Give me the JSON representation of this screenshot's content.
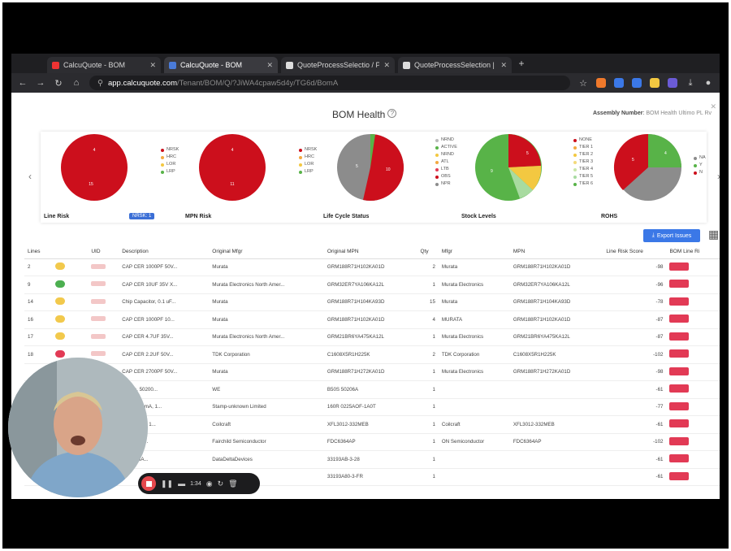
{
  "browser": {
    "tabs": [
      {
        "label": "CalcuQuote - BOM",
        "active": false,
        "icon": "calcuquote-icon"
      },
      {
        "label": "CalcuQuote - BOM",
        "active": true,
        "icon": "calcuquote-icon"
      },
      {
        "label": "QuoteProcessSelectio / Pro",
        "active": false,
        "icon": "doc-icon"
      },
      {
        "label": "QuoteProcessSelection | Do",
        "active": false,
        "icon": "doc-icon"
      }
    ],
    "url_host": "app.calcuquote.com",
    "url_path": "/Tenant/BOM/Q/?JiWA4cpaw5d4y/TG6d/BomA"
  },
  "app": {
    "title": "BOM Health",
    "assembly_label": "Assembly Number",
    "assembly_value": "BOM Health Ultimo PL Rv",
    "charts": [
      {
        "title": "Line Risk",
        "legend": [
          "NRSK",
          "HRC",
          "LOR",
          "LRP"
        ]
      },
      {
        "title": "MPN Risk",
        "legend": [
          "NRSK",
          "HRC",
          "LOR",
          "LRP"
        ]
      },
      {
        "title": "Life Cycle Status",
        "legend": [
          "NRND",
          "ACTIVE",
          "NRND",
          "ATL",
          "LTB",
          "OBS",
          "NPR"
        ]
      },
      {
        "title": "Stock Levels",
        "legend": [
          "NONE",
          "TIER 1",
          "TIER 2",
          "TIER 3",
          "TIER 4",
          "TIER 5",
          "TIER 6"
        ]
      },
      {
        "title": "ROHS",
        "legend": [
          "NA",
          "Y",
          "N"
        ]
      }
    ],
    "hover_chip": "NRSK: 1",
    "export_label": "Export Issues",
    "columns": [
      "Lines",
      "",
      "UID",
      "Description",
      "Original Mfgr",
      "Original MPN",
      "Qty",
      "Mfgr",
      "MPN",
      "Line Risk Score",
      "BOM Line Ri"
    ],
    "rows": [
      {
        "line": "2",
        "color": "#f2c94c",
        "desc": "CAP CER 1000PF 50V...",
        "omfg": "Murata",
        "ompn": "GRM188R71H102KA01D",
        "qty": "2",
        "mfgr": "Murata",
        "mpn": "GRM188R71H102KA01D",
        "score": "-98"
      },
      {
        "line": "9",
        "color": "#4caf50",
        "desc": "CAP CER 10UF 35V X...",
        "omfg": "Murata Electronics North Amer...",
        "ompn": "GRM32ER7YA106KA12L",
        "qty": "1",
        "mfgr": "Murata Electronics",
        "mpn": "GRM32ER7YA106KA12L",
        "score": "-96"
      },
      {
        "line": "14",
        "color": "#f2c94c",
        "desc": "Chip Capacitor, 0.1 uF...",
        "omfg": "Murata",
        "ompn": "GRM188R71H104KA93D",
        "qty": "15",
        "mfgr": "Murata",
        "mpn": "GRM188R71H104KA93D",
        "score": "-78"
      },
      {
        "line": "16",
        "color": "#f2c94c",
        "desc": "CAP CER 1000PF 10...",
        "omfg": "Murata",
        "ompn": "GRM188R71H102KA01D",
        "qty": "4",
        "mfgr": "MURATA",
        "mpn": "GRM188R71H102KA01D",
        "score": "-87"
      },
      {
        "line": "17",
        "color": "#f2c94c",
        "desc": "CAP CER 4.7UF 35V...",
        "omfg": "Murata Electronics North Amer...",
        "ompn": "GRM21BR6YA475KA12L",
        "qty": "1",
        "mfgr": "Murata Electronics",
        "mpn": "GRM21BR6YA475KA12L",
        "score": "-87"
      },
      {
        "line": "18",
        "color": "#e23a55",
        "desc": "CAP CER 2.2UF 50V...",
        "omfg": "TDK Corporation",
        "ompn": "C1608X5R1H225K",
        "qty": "2",
        "mfgr": "TDK Corporation",
        "mpn": "C1608X5R1H225K",
        "score": "-102"
      },
      {
        "line": "",
        "color": "#f2c94c",
        "desc": "CAP CER 2700PF 50V...",
        "omfg": "Murata",
        "ompn": "GRM188R71H272KA01D",
        "qty": "1",
        "mfgr": "Murata Electronics",
        "mpn": "GRM188R71H272KA01D",
        "score": "-98"
      },
      {
        "line": "",
        "color": "#f2c94c",
        "desc": "Bridge, 50200...",
        "omfg": "WE",
        "ompn": "B50S 50206A",
        "qty": "1",
        "mfgr": "",
        "mpn": "",
        "score": "-61"
      },
      {
        "line": "",
        "color": "#f2c94c",
        "desc": "Fuse, 400mA, 1...",
        "omfg": "Stamp-unknown Limited",
        "ompn": "160R 0225AOF-1A0T",
        "qty": "1",
        "mfgr": "",
        "mpn": "",
        "score": "-77"
      },
      {
        "line": "",
        "color": "#f2c94c",
        "desc": "TR, 3.3A/L, 1...",
        "omfg": "Coilcraft",
        "ompn": "XFL3012-332MEB",
        "qty": "1",
        "mfgr": "Coilcraft",
        "mpn": "XFL3012-332MEB",
        "score": "-61"
      },
      {
        "line": "",
        "color": "#f2c94c",
        "desc": "CH 30V 1...",
        "omfg": "Fairchild Semiconductor",
        "ompn": "FDC6364AP",
        "qty": "1",
        "mfgr": "ON Semiconductor",
        "mpn": "FDC6364AP",
        "score": "-102"
      },
      {
        "line": "",
        "color": "#f2c94c",
        "desc": "3.3V 0.8A...",
        "omfg": "DataDeltaDevices",
        "ompn": "33193AB-3-28",
        "qty": "1",
        "mfgr": "",
        "mpn": "",
        "score": "-61"
      },
      {
        "line": "",
        "color": "#f2c94c",
        "desc": "",
        "omfg": "",
        "ompn": "33193A80-3-FR",
        "qty": "1",
        "mfgr": "",
        "mpn": "",
        "score": "-61"
      }
    ]
  },
  "recorder": {
    "time": "1:34"
  },
  "colors": {
    "red": "#cc0f1c",
    "green": "#58b348",
    "gray": "#8c8c8c",
    "yellow": "#f3c841",
    "accent": "#3b78e7"
  }
}
